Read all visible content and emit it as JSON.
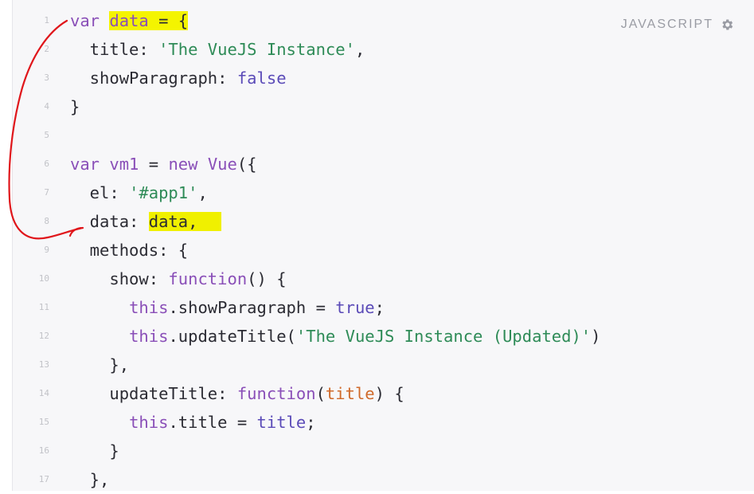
{
  "editor": {
    "language_label": "JAVASCRIPT",
    "settings_icon": "gear-icon",
    "colors": {
      "background": "#f7f7f9",
      "keyword": "#8a4fb8",
      "string": "#2e8b57",
      "value": "#5b4bb8",
      "param": "#d06a2a",
      "highlight": "#f4f400",
      "annotation": "#e0161b"
    },
    "lines": [
      {
        "n": "1",
        "t": [
          "var",
          " ",
          "data",
          " = {"
        ]
      },
      {
        "n": "2",
        "t": [
          "  title: ",
          "'The VueJS Instance'",
          ","
        ]
      },
      {
        "n": "3",
        "t": [
          "  showParagraph: ",
          "false"
        ]
      },
      {
        "n": "4",
        "t": [
          "}"
        ]
      },
      {
        "n": "5",
        "t": [
          ""
        ]
      },
      {
        "n": "6",
        "t": [
          "var",
          " ",
          "vm1",
          " = ",
          "new",
          " ",
          "Vue",
          "({"
        ]
      },
      {
        "n": "7",
        "t": [
          "  el: ",
          "'#app1'",
          ","
        ]
      },
      {
        "n": "8",
        "t": [
          "  data: ",
          "data,"
        ]
      },
      {
        "n": "9",
        "t": [
          "  methods: {"
        ]
      },
      {
        "n": "10",
        "t": [
          "    show: ",
          "function",
          "() {"
        ]
      },
      {
        "n": "11",
        "t": [
          "      ",
          "this",
          ".showParagraph = ",
          "true",
          ";"
        ]
      },
      {
        "n": "12",
        "t": [
          "      ",
          "this",
          ".updateTitle(",
          "'The VueJS Instance (Updated)'",
          ")"
        ]
      },
      {
        "n": "13",
        "t": [
          "    },"
        ]
      },
      {
        "n": "14",
        "t": [
          "    updateTitle: ",
          "function",
          "(",
          "title",
          ") {"
        ]
      },
      {
        "n": "15",
        "t": [
          "      ",
          "this",
          ".title = ",
          "title",
          ";"
        ]
      },
      {
        "n": "16",
        "t": [
          "    }"
        ]
      },
      {
        "n": "17",
        "t": [
          "  },"
        ]
      }
    ]
  }
}
